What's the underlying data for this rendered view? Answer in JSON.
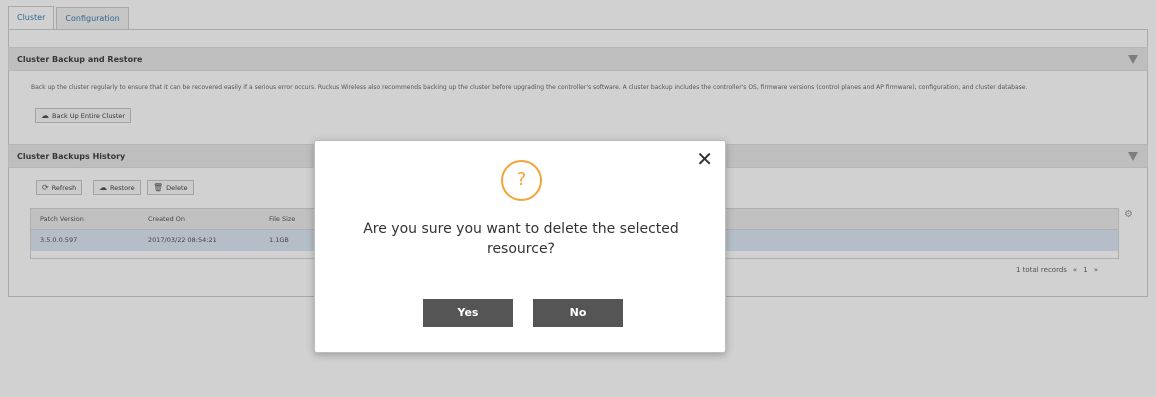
{
  "tabs": [
    {
      "label": "Cluster"
    },
    {
      "label": "Configuration"
    }
  ],
  "backup_section": {
    "title": "Cluster Backup and Restore",
    "description": "Back up the cluster regularly to ensure that it can be recovered easily if a serious error occurs. Ruckus Wireless also recommends backing up the cluster before upgrading the controller's software. A cluster backup includes the controller's OS, firmware versions (control planes and AP firmware), configuration, and cluster database.",
    "backup_button": "Back Up Entire Cluster"
  },
  "history_section": {
    "title": "Cluster Backups History",
    "toolbar": {
      "refresh": "Refresh",
      "restore": "Restore",
      "delete": "Delete"
    },
    "columns": [
      "Patch Version",
      "Created On",
      "File Size"
    ],
    "rows": [
      [
        "3.5.0.0.597",
        "2017/03/22 08:54:21",
        "1.1GB"
      ]
    ],
    "pager": {
      "total": "1 total records",
      "prev": "«",
      "page": "1",
      "next": "»"
    }
  },
  "modal": {
    "icon": "?",
    "message": "Are you sure you want to delete the selected resource?",
    "yes": "Yes",
    "no": "No",
    "close": "✕"
  },
  "icons": {
    "collapse": "triangle-down-icon",
    "settings": "gear-icon",
    "cloud": "cloud-upload-icon",
    "refresh": "refresh-icon",
    "trash": "trash-icon",
    "question": "question-icon",
    "close": "close-icon"
  },
  "colors": {
    "modal_button": "#555555",
    "question_icon": "#f3a338",
    "selected_row": "#dde8f5",
    "link": "#3a7fb0"
  }
}
